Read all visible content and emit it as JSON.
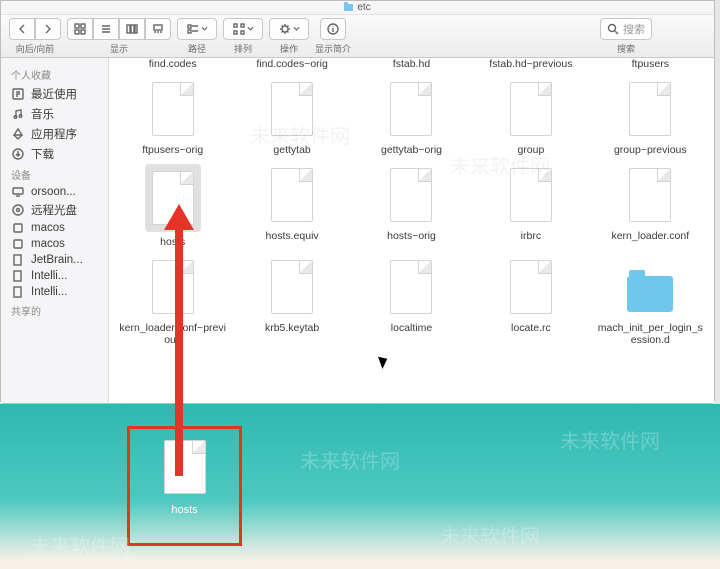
{
  "window": {
    "title": "etc"
  },
  "toolbar": {
    "nav_label": "向后/向前",
    "view_label": "显示",
    "path_label": "路径",
    "sort_label": "排列",
    "action_label": "操作",
    "info_label": "显示简介",
    "search_placeholder": "搜索",
    "search_label": "搜索"
  },
  "sidebar": {
    "favorites_header": "个人收藏",
    "favorites": [
      {
        "label": "最近使用",
        "icon": "clock-icon"
      },
      {
        "label": "音乐",
        "icon": "music-icon"
      },
      {
        "label": "应用程序",
        "icon": "apps-icon"
      },
      {
        "label": "下载",
        "icon": "download-icon"
      }
    ],
    "devices_header": "设备",
    "devices": [
      {
        "label": "orsoon...",
        "icon": "monitor-icon"
      },
      {
        "label": "远程光盘",
        "icon": "disc-icon"
      },
      {
        "label": "macos",
        "icon": "disk-icon"
      },
      {
        "label": "macos",
        "icon": "disk-icon"
      },
      {
        "label": "JetBrain...",
        "icon": "page-icon"
      },
      {
        "label": "Intelli...",
        "icon": "page-icon"
      },
      {
        "label": "Intelli...",
        "icon": "page-icon"
      }
    ],
    "shared_header": "共享的"
  },
  "files": {
    "row": [
      {
        "name": "find.codes"
      },
      {
        "name": "find.codes~orig"
      },
      {
        "name": "fstab.hd"
      },
      {
        "name": "fstab.hd~previous"
      },
      {
        "name": "ftpusers"
      }
    ],
    "row2": [
      {
        "name": "ftpusers~orig"
      },
      {
        "name": "gettytab"
      },
      {
        "name": "gettytab~orig"
      },
      {
        "name": "group"
      },
      {
        "name": "group~previous"
      }
    ],
    "row3": [
      {
        "name": "hosts",
        "selected": true
      },
      {
        "name": "hosts.equiv"
      },
      {
        "name": "hosts~orig"
      },
      {
        "name": "irbrc"
      },
      {
        "name": "kern_loader.conf"
      }
    ],
    "row4": [
      {
        "name": "kern_loader.conf~previous"
      },
      {
        "name": "krb5.keytab"
      },
      {
        "name": "localtime"
      },
      {
        "name": "locate.rc"
      },
      {
        "name": "mach_init_per_login_session.d",
        "folder": true
      }
    ]
  },
  "desktop": {
    "file": "hosts"
  },
  "watermark": "未来软件网"
}
